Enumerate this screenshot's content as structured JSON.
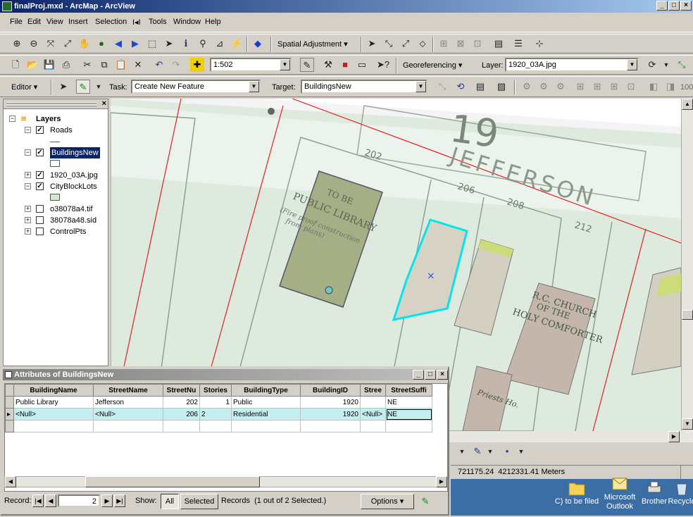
{
  "window": {
    "title": "finalProj.mxd - ArcMap - ArcView"
  },
  "menu": [
    "File",
    "Edit",
    "View",
    "Insert",
    "Selection",
    "Tools",
    "Window",
    "Help"
  ],
  "toolbar1": {
    "spatial_adjustment": "Spatial Adjustment"
  },
  "toolbar2": {
    "scale": "1:502",
    "georeferencing": "Georeferencing",
    "layer_label": "Layer:",
    "layer_value": "1920_03A.jpg"
  },
  "editor": {
    "editor_label": "Editor",
    "task_label": "Task:",
    "task_value": "Create New Feature",
    "target_label": "Target:",
    "target_value": "BuildingsNew",
    "right_partial": "100"
  },
  "toc": {
    "root": "Layers",
    "layers": [
      {
        "name": "Roads",
        "checked": true,
        "expanded": true
      },
      {
        "name": "BuildingsNew",
        "checked": true,
        "expanded": true,
        "selected": true
      },
      {
        "name": "1920_03A.jpg",
        "checked": true,
        "expanded": false
      },
      {
        "name": "CityBlockLots",
        "checked": true,
        "expanded": true
      },
      {
        "name": "o38078a4.tif",
        "checked": false,
        "expanded": false
      },
      {
        "name": "38078a48.sid",
        "checked": false,
        "expanded": false
      },
      {
        "name": "ControlPts",
        "checked": false,
        "expanded": false
      }
    ]
  },
  "map": {
    "block_number": "19",
    "street_name": "JEFFERSON",
    "addresses": [
      "202",
      "206",
      "208",
      "212"
    ],
    "library_text": [
      "TO BE",
      "PUBLIC LIBRARY",
      "(Fire proof construction",
      "from plans)"
    ],
    "church_text": [
      "R.C. CHURCH",
      "OF THE",
      "HOLY COMFORTER"
    ],
    "misc_text": [
      "Priests Ho."
    ]
  },
  "attributes": {
    "title": "Attributes of BuildingsNew",
    "columns": [
      "BuildingName",
      "StreetName",
      "StreetNu",
      "Stories",
      "BuildingType",
      "BuildingID",
      "Stree",
      "StreetSuffi"
    ],
    "rows": [
      [
        "Public Library",
        "Jefferson",
        "202",
        "1",
        "Public",
        "1920",
        "",
        "NE"
      ],
      [
        "<Null>",
        "<Null>",
        "206",
        "2",
        "Residential",
        "1920",
        "<Null>",
        "NE"
      ]
    ],
    "record_label": "Record:",
    "record_value": "2",
    "show_label": "Show:",
    "all_label": "All",
    "selected_label": "Selected",
    "records_text": "Records  (1 out of 2 Selected.)",
    "options_label": "Options"
  },
  "status": {
    "coords": "721175.24  4212331.41 Meters"
  },
  "desktop": [
    {
      "label": "C) to be filed"
    },
    {
      "label": "Microsoft Outlook"
    },
    {
      "label": "Brother"
    },
    {
      "label": "Recycle"
    }
  ],
  "colors": {
    "title_active": "#0a246a",
    "selection": "#00e5ee",
    "lot_fill": "#cfe8cf",
    "road": "#e02020",
    "desktop": "#3a6ea5"
  }
}
